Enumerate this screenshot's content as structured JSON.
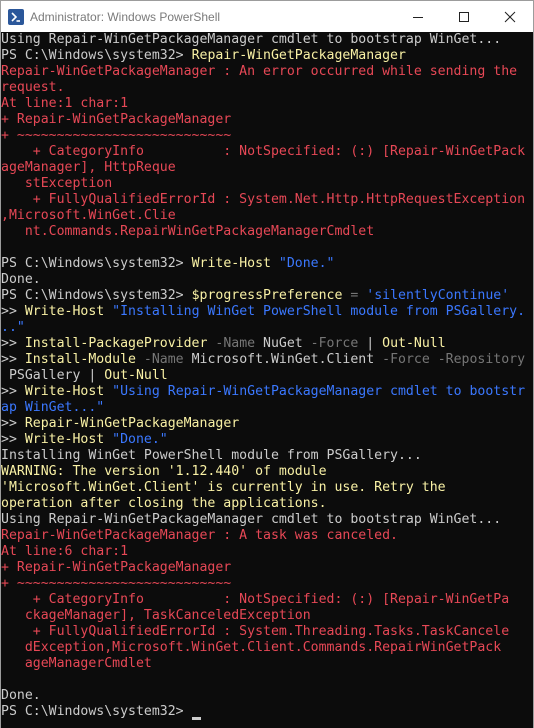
{
  "window": {
    "title": "Administrator: Windows PowerShell"
  },
  "console": {
    "lines": [
      [
        {
          "t": "Using Repair-WinGetPackageManager cmdlet to bootstrap WinGet...",
          "c": "w"
        }
      ],
      [
        {
          "t": "PS C:\\Windows\\system32> ",
          "c": "w"
        },
        {
          "t": "Repair-WinGetPackageManager",
          "c": "y"
        }
      ],
      [
        {
          "t": "Repair-WinGetPackageManager : An error occurred while sending the",
          "c": "r"
        }
      ],
      [
        {
          "t": "request.",
          "c": "r"
        }
      ],
      [
        {
          "t": "At line:1 char:1",
          "c": "r"
        }
      ],
      [
        {
          "t": "+ Repair-WinGetPackageManager",
          "c": "r"
        }
      ],
      [
        {
          "t": "+ ~~~~~~~~~~~~~~~~~~~~~~~~~~~",
          "c": "r"
        }
      ],
      [
        {
          "t": "    + CategoryInfo          : NotSpecified: (:) [Repair-WinGetPack",
          "c": "r"
        }
      ],
      [
        {
          "t": "ageManager], HttpReque",
          "c": "r"
        }
      ],
      [
        {
          "t": "   stException",
          "c": "r"
        }
      ],
      [
        {
          "t": "    + FullyQualifiedErrorId : System.Net.Http.HttpRequestException",
          "c": "r"
        }
      ],
      [
        {
          "t": ",Microsoft.WinGet.Clie",
          "c": "r"
        }
      ],
      [
        {
          "t": "   nt.Commands.RepairWinGetPackageManagerCmdlet",
          "c": "r"
        }
      ],
      [
        {
          "t": "",
          "c": "w"
        }
      ],
      [
        {
          "t": "PS C:\\Windows\\system32> ",
          "c": "w"
        },
        {
          "t": "Write-Host ",
          "c": "y"
        },
        {
          "t": "\"Done.\"",
          "c": "b"
        }
      ],
      [
        {
          "t": "Done.",
          "c": "w"
        }
      ],
      [
        {
          "t": "PS C:\\Windows\\system32> ",
          "c": "w"
        },
        {
          "t": "$progressPreference",
          "c": "y"
        },
        {
          "t": " = ",
          "c": "g"
        },
        {
          "t": "'silentlyContinue'",
          "c": "b"
        }
      ],
      [
        {
          "t": ">> ",
          "c": "w"
        },
        {
          "t": "Write-Host ",
          "c": "y"
        },
        {
          "t": "\"Installing WinGet PowerShell module from PSGallery.",
          "c": "b"
        }
      ],
      [
        {
          "t": "..\"",
          "c": "b"
        }
      ],
      [
        {
          "t": ">> ",
          "c": "w"
        },
        {
          "t": "Install-PackageProvider ",
          "c": "y"
        },
        {
          "t": "-Name ",
          "c": "g"
        },
        {
          "t": "NuGet ",
          "c": "w"
        },
        {
          "t": "-Force ",
          "c": "g"
        },
        {
          "t": "| ",
          "c": "w"
        },
        {
          "t": "Out-Null",
          "c": "y"
        }
      ],
      [
        {
          "t": ">> ",
          "c": "w"
        },
        {
          "t": "Install-Module ",
          "c": "y"
        },
        {
          "t": "-Name ",
          "c": "g"
        },
        {
          "t": "Microsoft.WinGet.Client ",
          "c": "w"
        },
        {
          "t": "-Force -Repository",
          "c": "g"
        }
      ],
      [
        {
          "t": " PSGallery ",
          "c": "w"
        },
        {
          "t": "| ",
          "c": "w"
        },
        {
          "t": "Out-Null",
          "c": "y"
        }
      ],
      [
        {
          "t": ">> ",
          "c": "w"
        },
        {
          "t": "Write-Host ",
          "c": "y"
        },
        {
          "t": "\"Using Repair-WinGetPackageManager cmdlet to bootstr",
          "c": "b"
        }
      ],
      [
        {
          "t": "ap WinGet...\"",
          "c": "b"
        }
      ],
      [
        {
          "t": ">> ",
          "c": "w"
        },
        {
          "t": "Repair-WinGetPackageManager",
          "c": "y"
        }
      ],
      [
        {
          "t": ">> ",
          "c": "w"
        },
        {
          "t": "Write-Host ",
          "c": "y"
        },
        {
          "t": "\"Done.\"",
          "c": "b"
        }
      ],
      [
        {
          "t": "Installing WinGet PowerShell module from PSGallery...",
          "c": "w"
        }
      ],
      [
        {
          "t": "WARNING: The version '1.12.440' of module",
          "c": "ye"
        }
      ],
      [
        {
          "t": "'Microsoft.WinGet.Client' is currently in use. Retry the",
          "c": "ye"
        }
      ],
      [
        {
          "t": "operation after closing the applications.",
          "c": "ye"
        }
      ],
      [
        {
          "t": "Using Repair-WinGetPackageManager cmdlet to bootstrap WinGet...",
          "c": "w"
        }
      ],
      [
        {
          "t": "Repair-WinGetPackageManager : A task was canceled.",
          "c": "r"
        }
      ],
      [
        {
          "t": "At line:6 char:1",
          "c": "r"
        }
      ],
      [
        {
          "t": "+ Repair-WinGetPackageManager",
          "c": "r"
        }
      ],
      [
        {
          "t": "+ ~~~~~~~~~~~~~~~~~~~~~~~~~~~",
          "c": "r"
        }
      ],
      [
        {
          "t": "    + CategoryInfo          : NotSpecified: (:) [Repair-WinGetPa",
          "c": "r"
        }
      ],
      [
        {
          "t": "   ckageManager], TaskCanceledException",
          "c": "r"
        }
      ],
      [
        {
          "t": "    + FullyQualifiedErrorId : System.Threading.Tasks.TaskCancele",
          "c": "r"
        }
      ],
      [
        {
          "t": "   dException,Microsoft.WinGet.Client.Commands.RepairWinGetPack",
          "c": "r"
        }
      ],
      [
        {
          "t": "   ageManagerCmdlet",
          "c": "r"
        }
      ],
      [
        {
          "t": "",
          "c": "w"
        }
      ],
      [
        {
          "t": "Done.",
          "c": "w"
        }
      ],
      [
        {
          "t": "PS C:\\Windows\\system32> ",
          "c": "w"
        }
      ]
    ]
  },
  "colors": {
    "background": "#0c0c0c",
    "text": "#cccccc",
    "error": "#e74856",
    "command": "#f9f1a5",
    "string": "#3b78ff",
    "parameter": "#767676"
  },
  "icons": {
    "app": "powershell-icon",
    "minimize": "minimize-icon",
    "maximize": "maximize-icon",
    "close": "close-icon"
  }
}
